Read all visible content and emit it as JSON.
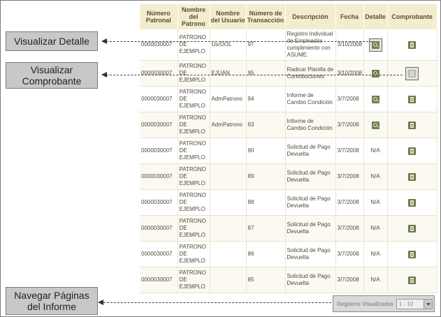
{
  "callouts": {
    "detail": "Visualizar Detalle",
    "receipt_line1": "Visualizar",
    "receipt_line2": "Comprobante",
    "pages_line1": "Navegar Páginas",
    "pages_line2": "del Informe"
  },
  "table": {
    "headers": {
      "patronal": "Número Patronal",
      "patrono": "Nombre del Patrono",
      "usuario": "Nombre del Usuario",
      "transaccion": "Número de Transacción",
      "descripcion": "Descripción",
      "fecha": "Fecha",
      "detalle": "Detalle",
      "comprobante": "Comprobante"
    },
    "rows": [
      {
        "patronal": "0000030007",
        "patrono": "PATRONO DE EJEMPLO",
        "usuario": "UsrDOL",
        "transaccion": "97",
        "descripcion": "Registro Individual de Empleados cumplimiento con ASUME.",
        "fecha": "3/10/2008",
        "detalle": "",
        "comprobante": ""
      },
      {
        "patronal": "0000030007",
        "patrono": "PATRONO DE EJEMPLO",
        "usuario": "EJUAN",
        "transaccion": "95",
        "descripcion": "Radicar Planilla de Contribuciones",
        "fecha": "3/10/2008",
        "detalle": "",
        "comprobante": ""
      },
      {
        "patronal": "0000030007",
        "patrono": "PATRONO DE EJEMPLO",
        "usuario": "AdmPatrono",
        "transaccion": "94",
        "descripcion": "Informe de Cambio Condición",
        "fecha": "3/7/2008",
        "detalle": "",
        "comprobante": ""
      },
      {
        "patronal": "0000030007",
        "patrono": "PATRONO DE EJEMPLO",
        "usuario": "AdmPatrono",
        "transaccion": "93",
        "descripcion": "Informe de Cambio Condición",
        "fecha": "3/7/2008",
        "detalle": "",
        "comprobante": ""
      },
      {
        "patronal": "0000030007",
        "patrono": "PATRONO DE EJEMPLO",
        "usuario": "",
        "transaccion": "90",
        "descripcion": "Solicitud de Pago Devuelta",
        "fecha": "3/7/2008",
        "detalle": "N/A",
        "comprobante": ""
      },
      {
        "patronal": "0000030007",
        "patrono": "PATRONO DE EJEMPLO",
        "usuario": "",
        "transaccion": "89",
        "descripcion": "Solicitud de Pago Devuelta",
        "fecha": "3/7/2008",
        "detalle": "N/A",
        "comprobante": ""
      },
      {
        "patronal": "0000030007",
        "patrono": "PATRONO DE EJEMPLO",
        "usuario": "",
        "transaccion": "88",
        "descripcion": "Solicitud de Pago Devuelta",
        "fecha": "3/7/2008",
        "detalle": "N/A",
        "comprobante": ""
      },
      {
        "patronal": "0000030007",
        "patrono": "PATRONO DE EJEMPLO",
        "usuario": "",
        "transaccion": "87",
        "descripcion": "Solicitud de Pago Devuelta",
        "fecha": "3/7/2008",
        "detalle": "N/A",
        "comprobante": ""
      },
      {
        "patronal": "0000030007",
        "patrono": "PATRONO DE EJEMPLO",
        "usuario": "",
        "transaccion": "86",
        "descripcion": "Solicitud de Pago Devuelta",
        "fecha": "3/7/2008",
        "detalle": "N/A",
        "comprobante": ""
      },
      {
        "patronal": "0000030007",
        "patrono": "PATRONO DE EJEMPLO",
        "usuario": "",
        "transaccion": "85",
        "descripcion": "Solicitud de Pago Devuelta",
        "fecha": "3/7/2008",
        "detalle": "N/A",
        "comprobante": ""
      }
    ]
  },
  "pager": {
    "label": "Registros Visualizados",
    "selected": "1 - 10"
  },
  "icons": {
    "detail": "magnifier-icon",
    "receipt": "receipt-icon"
  }
}
